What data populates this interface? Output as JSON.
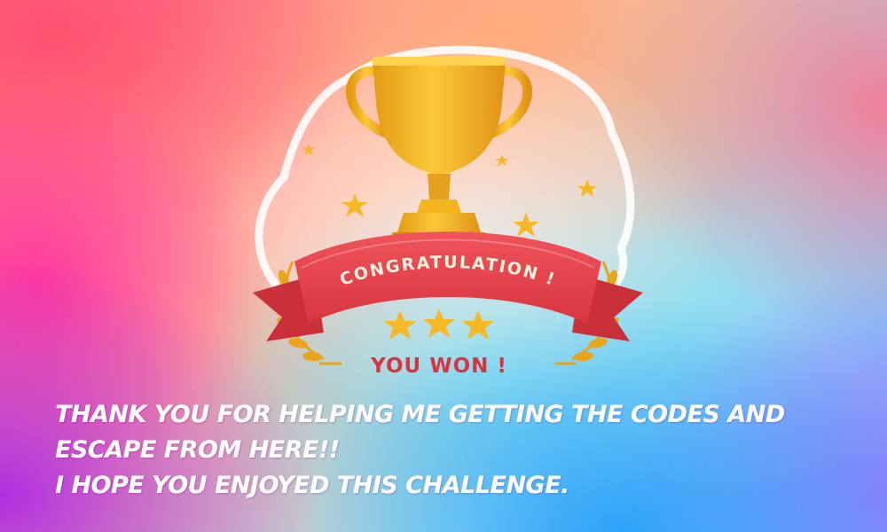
{
  "badge": {
    "ribbon_text": "CONGRATULATION !",
    "subtitle": "YOU WON !"
  },
  "message": {
    "line1": "THANK YOU FOR HELPING  ME GETTING THE CODES AND",
    "line2": "ESCAPE FROM HERE!!",
    "line3": "I HOPE YOU ENJOYED THIS CHALLENGE."
  },
  "colors": {
    "trophy_gold": "#f5b51c",
    "ribbon_red": "#e8404a",
    "star_gold": "#f7b825",
    "subtitle_red": "#d8343f"
  },
  "icons": [
    "trophy-icon",
    "star-icon",
    "laurel-icon"
  ]
}
